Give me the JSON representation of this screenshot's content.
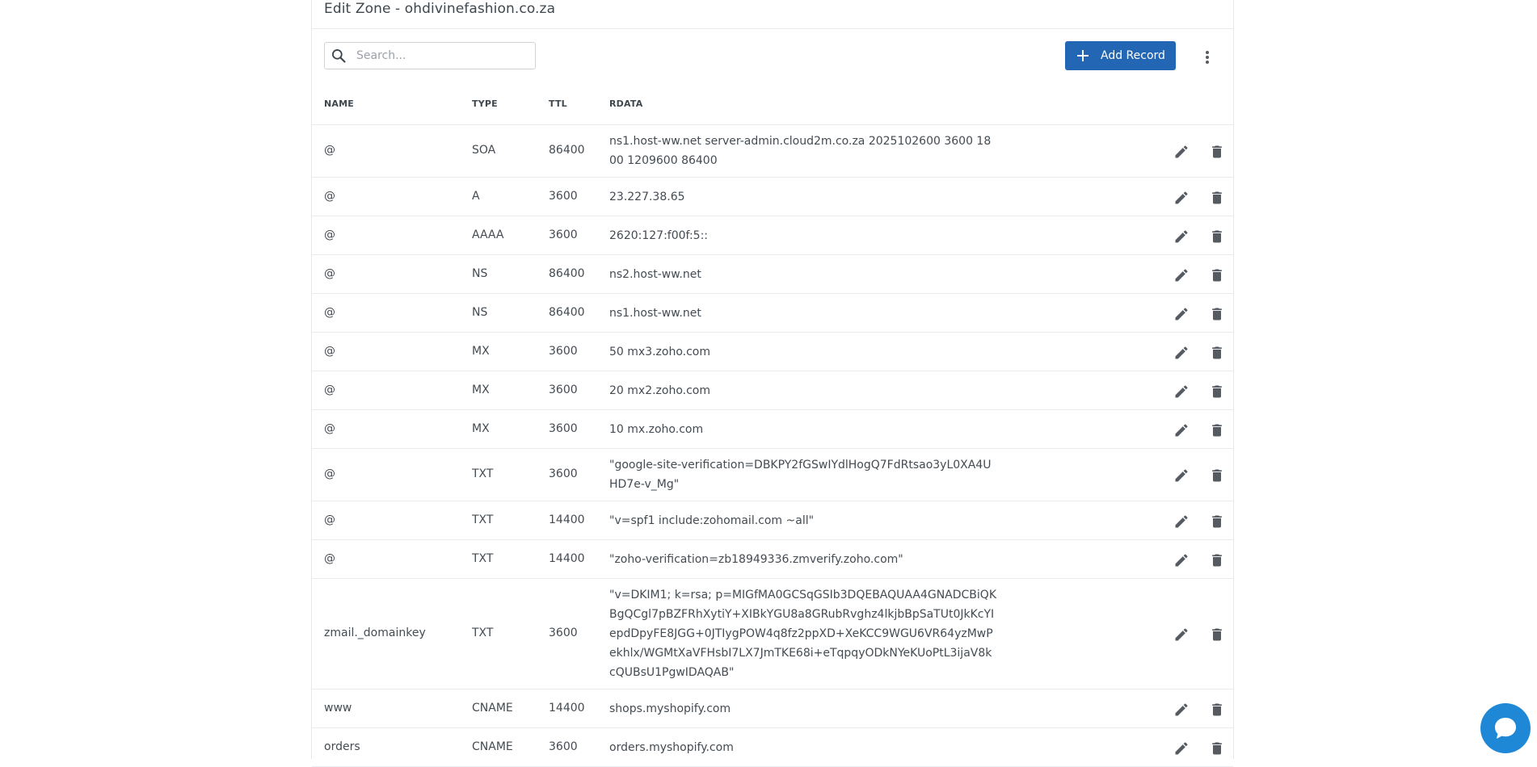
{
  "page": {
    "title": "Edit Zone - ohdivinefashion.co.za"
  },
  "toolbar": {
    "search_placeholder": "Search...",
    "add_record_label": "Add Record"
  },
  "table": {
    "columns": [
      "NAME",
      "TYPE",
      "TTL",
      "RDATA"
    ],
    "rows": [
      {
        "name": "@",
        "type": "SOA",
        "ttl": "86400",
        "rdata": "ns1.host-ww.net server-admin.cloud2m.co.za 2025102600 3600 1800 1209600 86400"
      },
      {
        "name": "@",
        "type": "A",
        "ttl": "3600",
        "rdata": "23.227.38.65"
      },
      {
        "name": "@",
        "type": "AAAA",
        "ttl": "3600",
        "rdata": "2620:127:f00f:5::"
      },
      {
        "name": "@",
        "type": "NS",
        "ttl": "86400",
        "rdata": "ns2.host-ww.net"
      },
      {
        "name": "@",
        "type": "NS",
        "ttl": "86400",
        "rdata": "ns1.host-ww.net"
      },
      {
        "name": "@",
        "type": "MX",
        "ttl": "3600",
        "rdata": "50 mx3.zoho.com"
      },
      {
        "name": "@",
        "type": "MX",
        "ttl": "3600",
        "rdata": "20 mx2.zoho.com"
      },
      {
        "name": "@",
        "type": "MX",
        "ttl": "3600",
        "rdata": "10 mx.zoho.com"
      },
      {
        "name": "@",
        "type": "TXT",
        "ttl": "3600",
        "rdata": "\"google-site-verification=DBKPY2fGSwIYdlHogQ7FdRtsao3yL0XA4UHD7e-v_Mg\""
      },
      {
        "name": "@",
        "type": "TXT",
        "ttl": "14400",
        "rdata": "\"v=spf1 include:zohomail.com ~all\""
      },
      {
        "name": "@",
        "type": "TXT",
        "ttl": "14400",
        "rdata": "\"zoho-verification=zb18949336.zmverify.zoho.com\""
      },
      {
        "name": "zmail._domainkey",
        "type": "TXT",
        "ttl": "3600",
        "rdata": "\"v=DKIM1; k=rsa; p=MIGfMA0GCSqGSIb3DQEBAQUAA4GNADCBiQKBgQCgl7pBZFRhXytiY+XIBkYGU8a8GRubRvghz4lkjbBpSaTUt0JkKcYIepdDpyFE8JGG+0JTIygPOW4q8fz2ppXD+XeKCC9WGU6VR64yzMwPekhlx/WGMtXaVFHsbI7LX7JmTKE68i+eTqpqyODkNYeKUoPtL3ijaV8kcQUBsU1PgwIDAQAB\""
      },
      {
        "name": "www",
        "type": "CNAME",
        "ttl": "14400",
        "rdata": "shops.myshopify.com"
      },
      {
        "name": "orders",
        "type": "CNAME",
        "ttl": "3600",
        "rdata": "orders.myshopify.com"
      }
    ]
  },
  "icons": {
    "search": "search-icon",
    "plus": "plus-icon",
    "more": "more-vertical-icon",
    "edit": "pencil-icon",
    "delete": "trash-icon",
    "chat": "chat-bubble-icon"
  },
  "colors": {
    "primary": "#2366b3",
    "chat": "#1e88d6",
    "icon": "#555b61"
  }
}
